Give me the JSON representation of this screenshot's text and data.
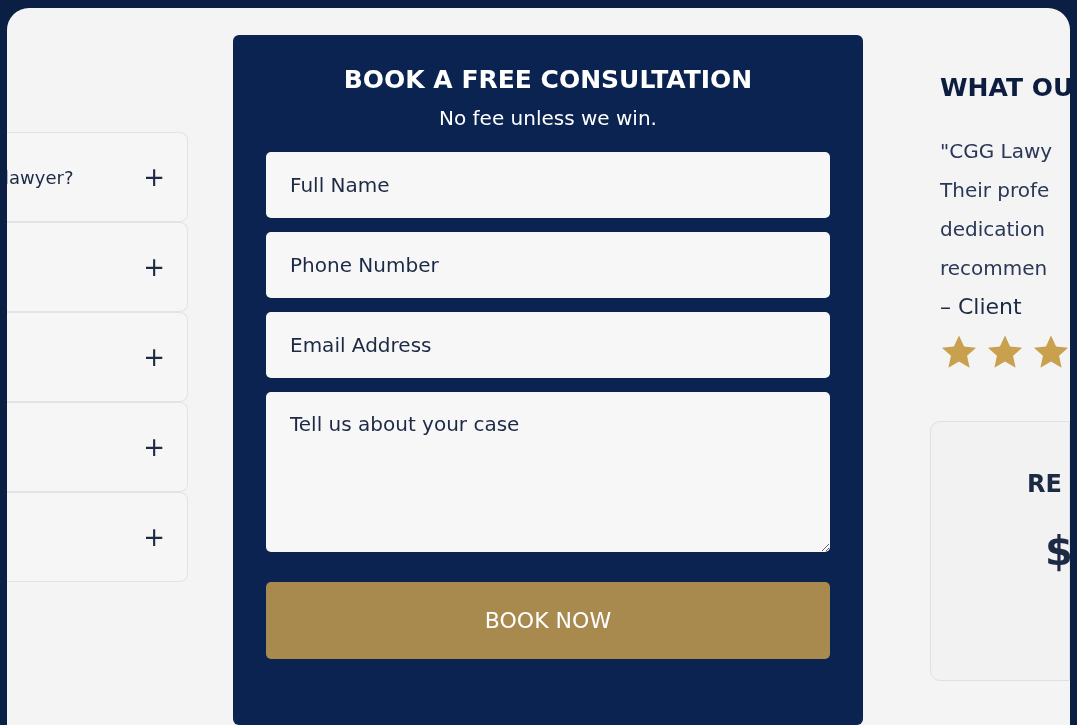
{
  "faq": [
    {
      "question": "lawyer?",
      "toggle": "+"
    },
    {
      "toggle": "+"
    },
    {
      "toggle": "+"
    },
    {
      "toggle": "+"
    },
    {
      "toggle": "+"
    }
  ],
  "form": {
    "title": "BOOK A FREE CONSULTATION",
    "subtitle": "No fee unless we win.",
    "fields": [
      {
        "kind": "input",
        "placeholder": "Full Name"
      },
      {
        "kind": "input",
        "placeholder": "Phone Number"
      },
      {
        "kind": "input",
        "placeholder": "Email Address"
      },
      {
        "kind": "textarea",
        "placeholder": "Tell us about your case"
      }
    ],
    "button": "BOOK NOW"
  },
  "testimonial": {
    "heading": "WHAT OU",
    "quote_lines": [
      "\"CGG Lawy",
      "Their profe",
      "dedication",
      "recommen"
    ],
    "author": "– Client",
    "stars": 3
  },
  "card": {
    "heading": "RE",
    "value": "$"
  }
}
